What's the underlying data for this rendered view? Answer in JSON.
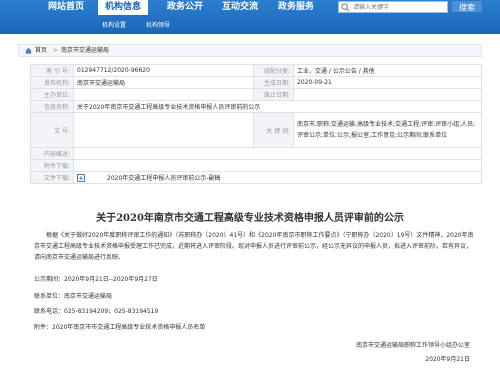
{
  "nav": {
    "items": [
      "网站首页",
      "机构信息",
      "政务公开",
      "互动交流",
      "政务服务"
    ],
    "subitems": [
      "机构设置",
      "机构领导"
    ],
    "search_placeholder": "请输入关键字",
    "search_button": "搜索",
    "accent": "#1a66b8"
  },
  "breadcrumb": {
    "home": "首页",
    "sep": ">",
    "current": "南京市交通运输局"
  },
  "meta": {
    "labels": {
      "index": "索 引 号:",
      "org": "发布机构:",
      "subject": "主办单位:",
      "title": "信息名称:",
      "docno": "文  号:",
      "content": "内容概述:",
      "attach": "附件下载:",
      "files": "文件下载:",
      "category": "组配分类:",
      "pubdate": "生成日期:",
      "expire": "废止日期:",
      "keywords": "关 键 词:"
    },
    "values": {
      "index": "012947712/2020-96620",
      "org": "南京市交通运输局",
      "subject": "",
      "title": "关于2020年南京市交通工程高级专业技术资格申报人员评审前的公示",
      "docno": "",
      "content": "",
      "attach": "",
      "files": "2020年交通工程申报人员评审前公示-副稿",
      "category": "工业，交通 / 公示公告 / 其他",
      "pubdate": "2020-09-21",
      "expire": "",
      "keywords": "南京市;职称;交通运输;高级专业技术;交通工程;评审;评审小组;人员;评审公示;单位;公示;报公室;工作意见;公示期间;联系单位"
    }
  },
  "article": {
    "title": "关于2020年南京市交通工程高级专业技术资格申报人员评审前的公示",
    "p1": "根据《关于做好2020年度职称评审工作的通知》（苏职称办〔2020〕41号）和《2020年南京市职称工作要点》（宁职称办〔2020〕19号）文件精神，2020年南京市交通工程高级专业技术资格申报受理工作已完成，近期将进入评审阶段。现对申报人员进行评审前公示，经公示无异议的申报人员，拟进入评审前阶。若有异议，请向南京市交通运输局进行反映。",
    "period": "公示期间：2020年9月21日--2020年9月27日",
    "unit": "联系单位：南京市交通运输局",
    "phone": "联系电话：025-83194209；025-83194519",
    "attachment": "附件：2020年南京市市交通工程高级专业技术资格申报人员名单",
    "signature": "南京市交通运输局职称工作领导小组办公室",
    "date": "2020年9月21日"
  }
}
